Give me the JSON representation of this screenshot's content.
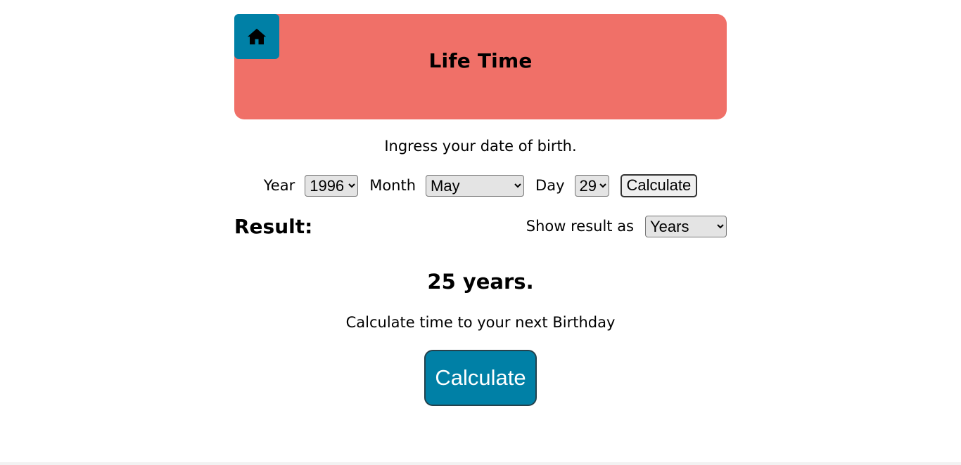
{
  "header": {
    "title": "Life Time",
    "home_icon": "home-icon"
  },
  "colors": {
    "header_bg": "#f07068",
    "accent": "#0080a6"
  },
  "form": {
    "instruction": "Ingress your date of birth.",
    "year_label": "Year",
    "year_value": "1996",
    "month_label": "Month",
    "month_value": "May",
    "day_label": "Day",
    "day_value": "29",
    "calculate_label": "Calculate"
  },
  "result": {
    "label": "Result:",
    "show_as_label": "Show result as",
    "unit_value": "Years",
    "value": "25 years."
  },
  "next_birthday": {
    "text": "Calculate time to your next Birthday",
    "button_label": "Calculate"
  }
}
